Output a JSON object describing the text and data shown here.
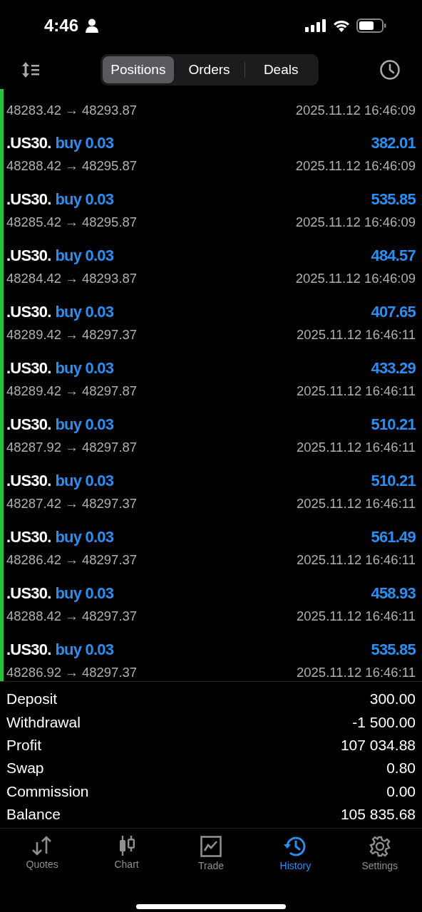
{
  "status_bar": {
    "time": "4:46"
  },
  "segments": [
    {
      "label": "Positions",
      "selected": true
    },
    {
      "label": "Orders",
      "selected": false
    },
    {
      "label": "Deals",
      "selected": false
    }
  ],
  "partial_row": {
    "prices": "48283.42 → 48293.87",
    "time": "2025.11.12 16:46:09"
  },
  "rows": [
    {
      "symbol": ".US30.",
      "side": "buy 0.03",
      "profit": "382.01",
      "prices": "48288.42 → 48295.87",
      "time": "2025.11.12 16:46:09"
    },
    {
      "symbol": ".US30.",
      "side": "buy 0.03",
      "profit": "535.85",
      "prices": "48285.42 → 48295.87",
      "time": "2025.11.12 16:46:09"
    },
    {
      "symbol": ".US30.",
      "side": "buy 0.03",
      "profit": "484.57",
      "prices": "48284.42 → 48293.87",
      "time": "2025.11.12 16:46:09"
    },
    {
      "symbol": ".US30.",
      "side": "buy 0.03",
      "profit": "407.65",
      "prices": "48289.42 → 48297.37",
      "time": "2025.11.12 16:46:11"
    },
    {
      "symbol": ".US30.",
      "side": "buy 0.03",
      "profit": "433.29",
      "prices": "48289.42 → 48297.87",
      "time": "2025.11.12 16:46:11"
    },
    {
      "symbol": ".US30.",
      "side": "buy 0.03",
      "profit": "510.21",
      "prices": "48287.92 → 48297.87",
      "time": "2025.11.12 16:46:11"
    },
    {
      "symbol": ".US30.",
      "side": "buy 0.03",
      "profit": "510.21",
      "prices": "48287.42 → 48297.37",
      "time": "2025.11.12 16:46:11"
    },
    {
      "symbol": ".US30.",
      "side": "buy 0.03",
      "profit": "561.49",
      "prices": "48286.42 → 48297.37",
      "time": "2025.11.12 16:46:11"
    },
    {
      "symbol": ".US30.",
      "side": "buy 0.03",
      "profit": "458.93",
      "prices": "48288.42 → 48297.37",
      "time": "2025.11.12 16:46:11"
    },
    {
      "symbol": ".US30.",
      "side": "buy 0.03",
      "profit": "535.85",
      "prices": "48286.92 → 48297.37",
      "time": "2025.11.12 16:46:11"
    }
  ],
  "summary": [
    {
      "label": "Deposit",
      "value": "300.00"
    },
    {
      "label": "Withdrawal",
      "value": "-1 500.00"
    },
    {
      "label": "Profit",
      "value": "107 034.88"
    },
    {
      "label": "Swap",
      "value": "0.80"
    },
    {
      "label": "Commission",
      "value": "0.00"
    },
    {
      "label": "Balance",
      "value": "105 835.68"
    }
  ],
  "tab_bar": [
    {
      "kind": "quotes",
      "label": "Quotes",
      "selected": false
    },
    {
      "kind": "chart",
      "label": "Chart",
      "selected": false
    },
    {
      "kind": "trade",
      "label": "Trade",
      "selected": false
    },
    {
      "kind": "history",
      "label": "History",
      "selected": true
    },
    {
      "kind": "settings",
      "label": "Settings",
      "selected": false
    }
  ]
}
